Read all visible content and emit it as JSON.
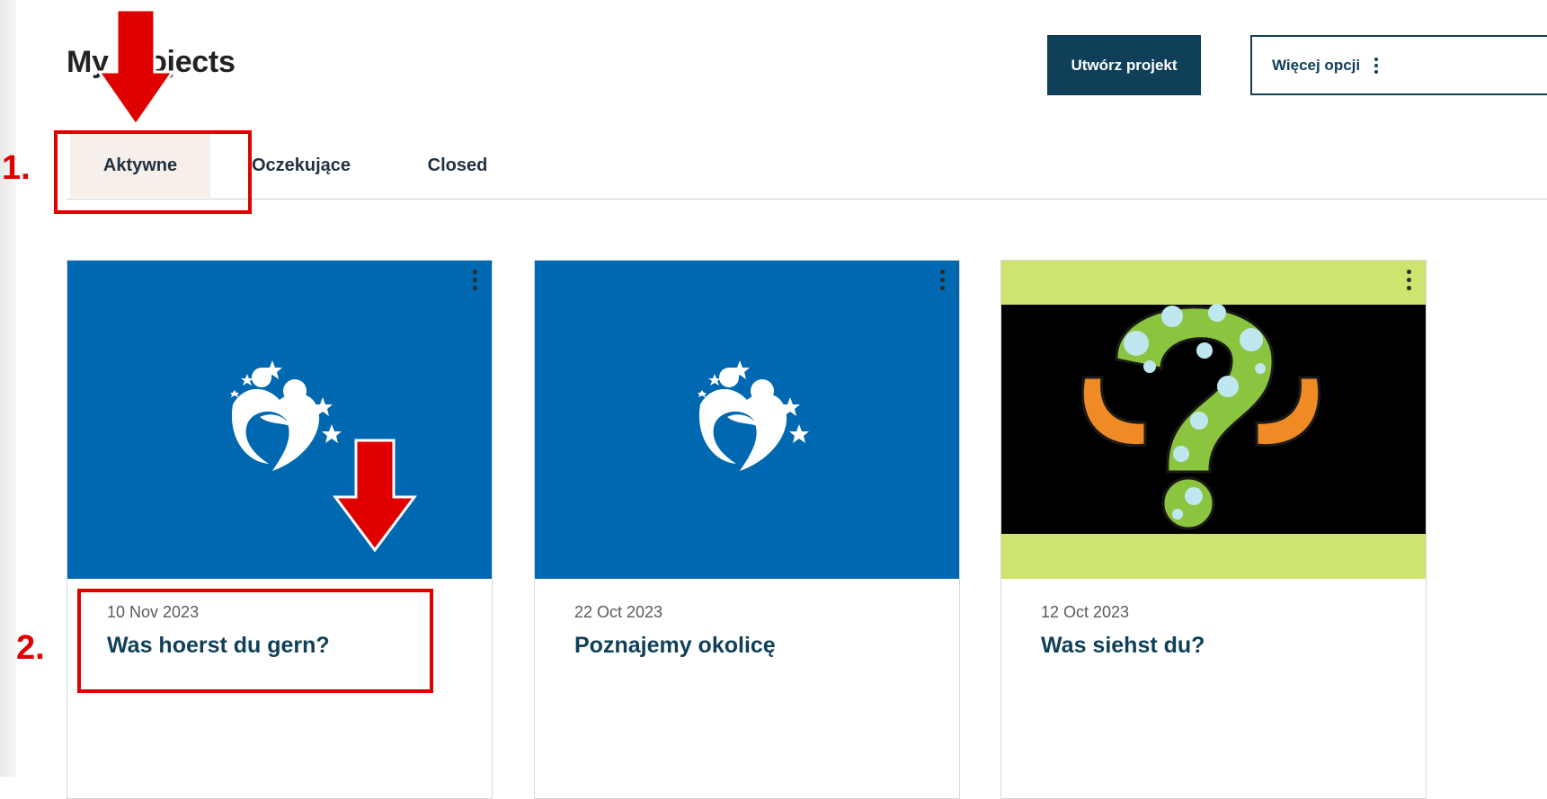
{
  "header": {
    "title": "My Projects",
    "create_label": "Utwórz projekt",
    "more_label": "Więcej opcji"
  },
  "tabs": [
    {
      "label": "Aktywne",
      "active": true
    },
    {
      "label": "Oczekujące",
      "active": false
    },
    {
      "label": "Closed",
      "active": false
    }
  ],
  "projects": [
    {
      "date": "10 Nov 2023",
      "title": "Was hoerst du gern?",
      "image": "child-with-stars-logo-icon",
      "image_bg": "#0068b0"
    },
    {
      "date": "22 Oct 2023",
      "title": "Poznajemy okolicę",
      "image": "child-with-stars-logo-icon",
      "image_bg": "#0068b0"
    },
    {
      "date": "12 Oct 2023",
      "title": "Was siehst du?",
      "image": "spotted-question-mark-icon",
      "image_bg": "#cde46e"
    }
  ],
  "annotations": [
    {
      "label": "1."
    },
    {
      "label": "2."
    }
  ],
  "colors": {
    "primary": "#0f3f59",
    "tab_active_bg": "#f7efe9",
    "card_image_blue": "#0068b0",
    "annotation_red": "#e00000"
  }
}
